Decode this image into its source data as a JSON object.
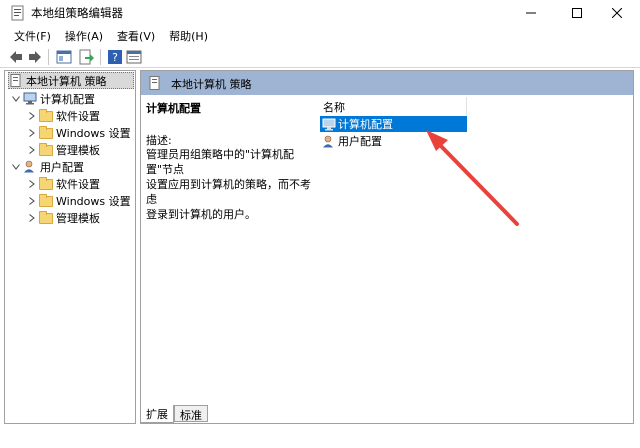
{
  "window": {
    "title": "本地组策略编辑器"
  },
  "menu": {
    "items": [
      {
        "label": "文件(F)"
      },
      {
        "label": "操作(A)"
      },
      {
        "label": "查看(V)"
      },
      {
        "label": "帮助(H)"
      }
    ]
  },
  "toolbar": {
    "buttons": [
      "back-icon",
      "forward-icon",
      "show-hide-tree-icon",
      "export-list-icon",
      "help-icon",
      "properties-icon"
    ]
  },
  "tree": {
    "root": "本地计算机 策略",
    "computer_config": "计算机配置",
    "user_config": "用户配置",
    "computer_children": [
      "软件设置",
      "Windows 设置",
      "管理模板"
    ],
    "user_children": [
      "软件设置",
      "Windows 设置",
      "管理模板"
    ]
  },
  "detail": {
    "header": "本地计算机 策略",
    "heading": "计算机配置",
    "desc_label": "描述:",
    "desc_lines": [
      "管理员用组策略中的\"计算机配置\"节点",
      "设置应用到计算机的策略，而不考虑",
      "登录到计算机的用户。"
    ],
    "column_name": "名称",
    "items": [
      {
        "label": "计算机配置",
        "selected": true
      },
      {
        "label": "用户配置",
        "selected": false
      }
    ]
  },
  "tabs": [
    {
      "label": "扩展",
      "active": true
    },
    {
      "label": "标准",
      "active": false
    }
  ],
  "colors": {
    "selection": "#0078d7",
    "header_band": "#9fb4d3",
    "annotation_arrow": "#e8423a"
  }
}
